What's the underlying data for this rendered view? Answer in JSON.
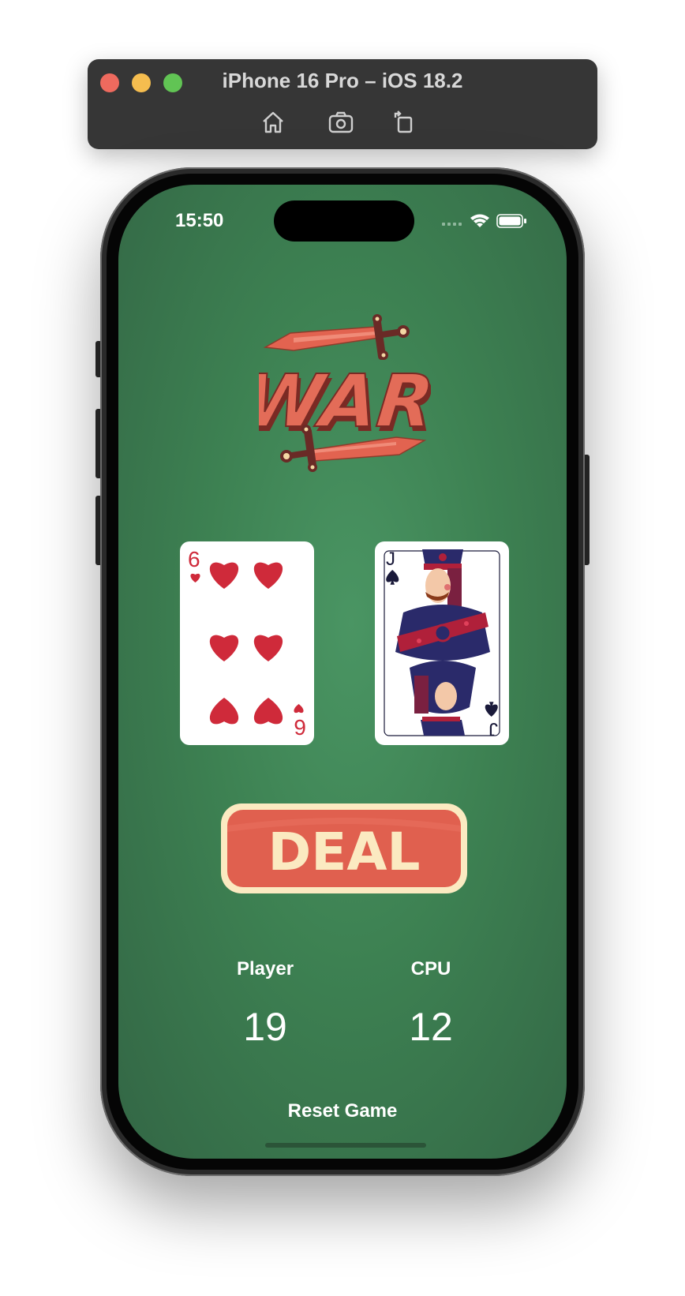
{
  "simulator": {
    "title": "iPhone 16 Pro – iOS 18.2",
    "tools": [
      "home-icon",
      "screenshot-icon",
      "rotate-icon"
    ]
  },
  "status_bar": {
    "time": "15:50",
    "icons": [
      "cellular-icon",
      "wifi-icon",
      "battery-icon"
    ]
  },
  "logo": {
    "text": "WAR"
  },
  "cards": {
    "player": {
      "rank": "6",
      "suit": "hearts",
      "suit_color": "#cf2a3a"
    },
    "cpu": {
      "rank": "J",
      "suit": "spades",
      "suit_color": "#1a1a3a"
    }
  },
  "deal_button": {
    "label": "DEAL",
    "fill": "#e0604f",
    "border": "#fbeac1"
  },
  "scores": {
    "player_label": "Player",
    "player_score": "19",
    "cpu_label": "CPU",
    "cpu_score": "12"
  },
  "reset_label": "Reset Game",
  "colors": {
    "felt": "#3d8152",
    "text": "#ffffff",
    "window_chrome": "#363636"
  }
}
